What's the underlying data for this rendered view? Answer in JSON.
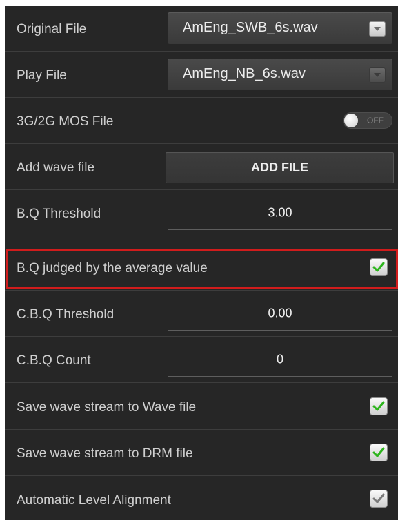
{
  "settings": {
    "original_file": {
      "label": "Original File",
      "value": "AmEng_SWB_6s.wav"
    },
    "play_file": {
      "label": "Play File",
      "value": "AmEng_NB_6s.wav"
    },
    "mos_file": {
      "label": "3G/2G MOS File",
      "toggle_state": "OFF"
    },
    "add_wave": {
      "label": "Add wave file",
      "button_label": "ADD FILE"
    },
    "bq_threshold": {
      "label": "B.Q Threshold",
      "value": "3.00"
    },
    "bq_average": {
      "label": "B.Q judged by the average value",
      "checked": true,
      "check_color": "#2db51d"
    },
    "cbq_threshold": {
      "label": "C.B.Q Threshold",
      "value": "0.00"
    },
    "cbq_count": {
      "label": "C.B.Q Count",
      "value": "0"
    },
    "save_wave": {
      "label": "Save wave stream to Wave file",
      "checked": true,
      "check_color": "#2db51d"
    },
    "save_drm": {
      "label": "Save wave stream to DRM file",
      "checked": true,
      "check_color": "#2db51d"
    },
    "auto_level": {
      "label": "Automatic Level Alignment",
      "checked": true,
      "check_color": "#7a7a7a"
    }
  },
  "colors": {
    "background": "#262626",
    "highlight_border": "#d11c1c"
  }
}
